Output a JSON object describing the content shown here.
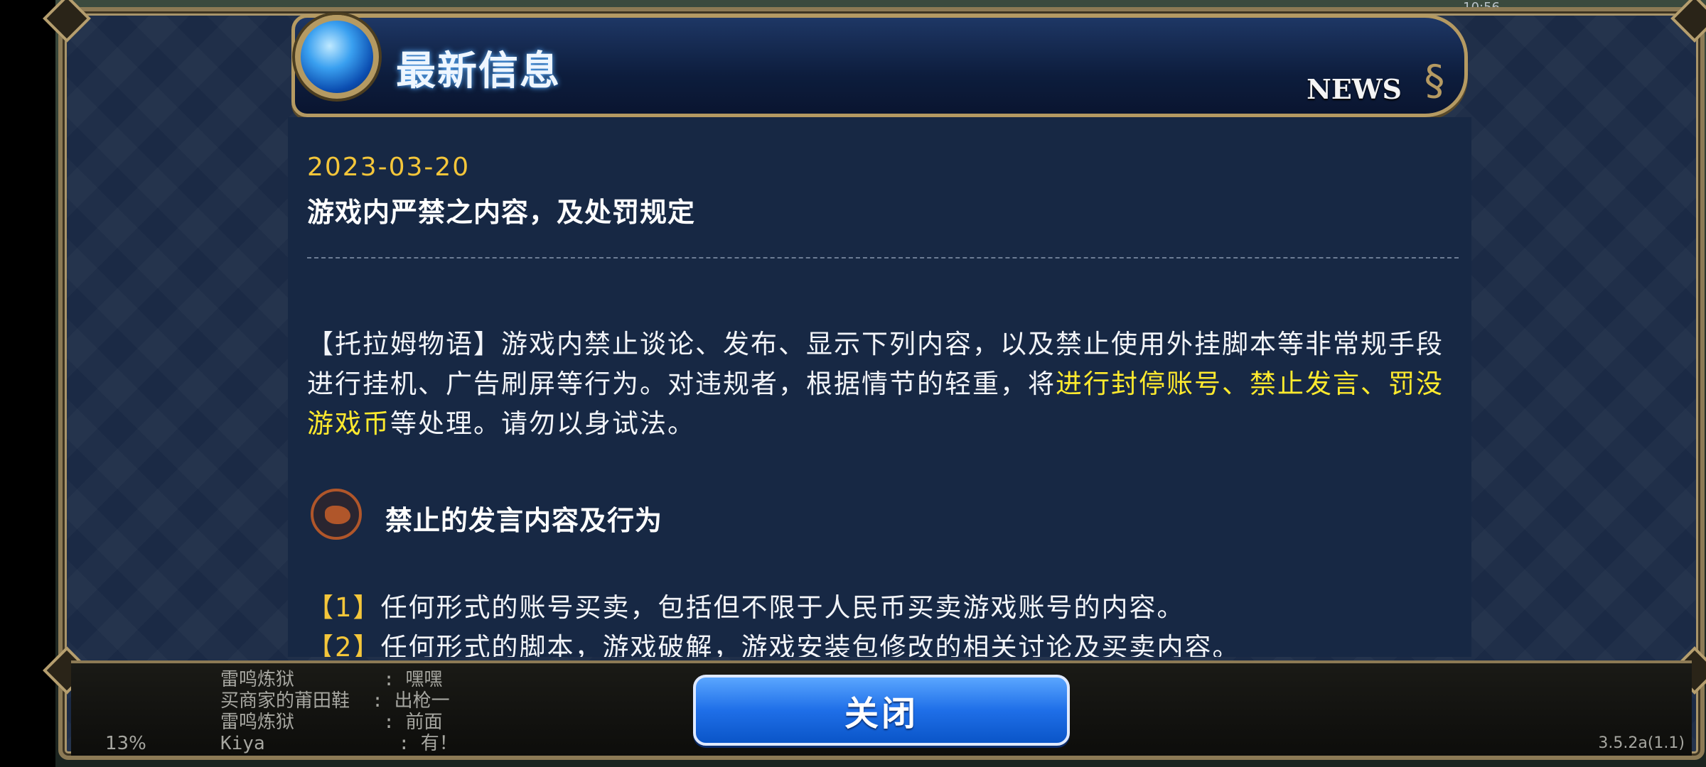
{
  "status": {
    "time": "10:56"
  },
  "header": {
    "title": "最新信息",
    "news_label": "NEWS"
  },
  "article": {
    "date": "2023-03-20",
    "title": "游戏内严禁之内容，及处罚规定",
    "para_part1": "【托拉姆物语】游戏内禁止谈论、发布、显示下列内容，以及禁止使用外挂脚本等非常规手段进行挂机、广告刷屏等行为。对违规者，根据情节的轻重，将",
    "para_highlight": "进行封停账号、禁止发言、罚没游戏币",
    "para_part2": "等处理。请勿以身试法。",
    "section_title": "禁止的发言内容及行为",
    "rules": [
      {
        "num": "【1】",
        "text": "任何形式的账号买卖，包括但不限于人民币买卖游戏账号的内容。"
      },
      {
        "num": "【2】",
        "text": "任何形式的脚本，游戏破解，游戏安装包修改的相关讨论及买卖内容。"
      }
    ]
  },
  "chat": {
    "lines": [
      "雷鸣炼狱        : 嘿嘿",
      "买商家的莆田鞋  : 出枪一",
      "雷鸣炼狱        : 前面",
      "Kiya            : 有！"
    ]
  },
  "footer": {
    "close_label": "关闭",
    "percent": "13%",
    "version": "3.5.2a(1.1)"
  },
  "colors": {
    "accent_gold": "#f4c63a",
    "highlight_yellow": "#ffea2e",
    "button_blue": "#1f6fe8",
    "panel_bg": "#172844"
  }
}
